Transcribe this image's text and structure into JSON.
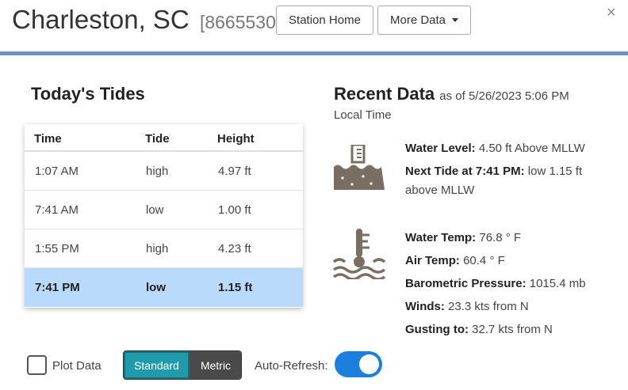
{
  "header": {
    "station_name": "Charleston, SC",
    "station_id": "[8665530]",
    "station_home_label": "Station Home",
    "more_data_label": "More Data",
    "close_symbol": "×"
  },
  "tides": {
    "title": "Today's Tides",
    "columns": [
      "Time",
      "Tide",
      "Height"
    ],
    "rows": [
      {
        "time": "1:07 AM",
        "tide": "high",
        "height": "4.97 ft"
      },
      {
        "time": "7:41 AM",
        "tide": "low",
        "height": "1.00 ft"
      },
      {
        "time": "1:55 PM",
        "tide": "high",
        "height": "4.23 ft"
      },
      {
        "time": "7:41 PM",
        "tide": "low",
        "height": "1.15 ft"
      }
    ],
    "highlighted_row": 3
  },
  "recent": {
    "title": "Recent Data",
    "as_of": "as of 5/26/2023 5:06 PM",
    "local_time": "Local Time",
    "water_level_label": "Water Level:",
    "water_level_value": "4.50 ft Above MLLW",
    "next_tide_label": "Next Tide at 7:41 PM:",
    "next_tide_value": "low 1.15 ft",
    "next_tide_value_2": "above MLLW",
    "water_temp_label": "Water Temp:",
    "water_temp_value": "76.8 ° F",
    "air_temp_label": "Air Temp:",
    "air_temp_value": "60.4 ° F",
    "pressure_label": "Barometric Pressure:",
    "pressure_value": "1015.4 mb",
    "winds_label": "Winds:",
    "winds_value": "23.3 kts from N",
    "gusting_label": "Gusting to:",
    "gusting_value": "32.7 kts from N",
    "icons": [
      "water-level-icon",
      "thermometer-water-icon"
    ]
  },
  "controls": {
    "plot_data_label": "Plot Data",
    "plot_data_checked": false,
    "standard_label": "Standard",
    "metric_label": "Metric",
    "selected_units": "Standard",
    "auto_refresh_label": "Auto-Refresh:",
    "auto_refresh_on": true
  },
  "colors": {
    "divider": "#6f94b6",
    "highlight_row": "#b9dafa",
    "standard_active": "#1f9bab",
    "metric_inactive": "#4a4a4a",
    "toggle_on": "#1c7fe0",
    "icon": "#7a6e62"
  }
}
